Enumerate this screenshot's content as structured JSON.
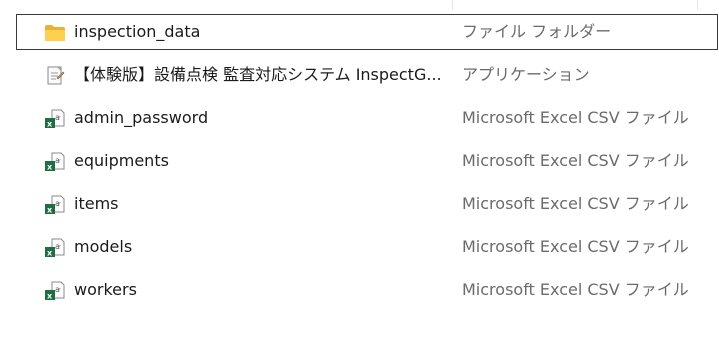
{
  "files": [
    {
      "name": "inspection_data",
      "type": "ファイル フォルダー",
      "icon": "folder-icon",
      "selected": true
    },
    {
      "name": "【体験版】設備点検 監査対応システム InspectG...",
      "type": "アプリケーション",
      "icon": "application-icon",
      "selected": false
    },
    {
      "name": "admin_password",
      "type": "Microsoft Excel CSV ファイル",
      "icon": "excel-csv-icon",
      "selected": false
    },
    {
      "name": "equipments",
      "type": "Microsoft Excel CSV ファイル",
      "icon": "excel-csv-icon",
      "selected": false
    },
    {
      "name": "items",
      "type": "Microsoft Excel CSV ファイル",
      "icon": "excel-csv-icon",
      "selected": false
    },
    {
      "name": "models",
      "type": "Microsoft Excel CSV ファイル",
      "icon": "excel-csv-icon",
      "selected": false
    },
    {
      "name": "workers",
      "type": "Microsoft Excel CSV ファイル",
      "icon": "excel-csv-icon",
      "selected": false
    }
  ],
  "colors": {
    "folder": "#ffcf48",
    "excel": "#1d6f42",
    "selection_border": "#3a3a3a",
    "type_text": "#6b6b6b"
  }
}
